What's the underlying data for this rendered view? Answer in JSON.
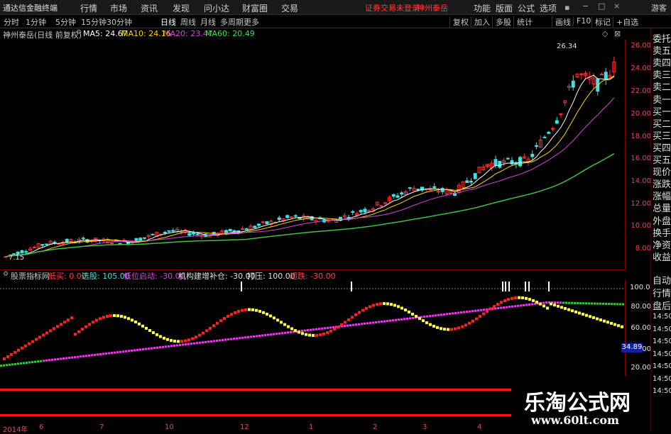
{
  "topbar": {
    "app_title": "通达信金融终端",
    "menu": [
      "行情",
      "市场",
      "资讯",
      "发现",
      "问小达",
      "财富圈",
      "交易"
    ],
    "warning": "证券交易未登录",
    "stock_name": "神州泰岳",
    "right_menu": [
      "功能",
      "版面",
      "公式",
      "选项"
    ],
    "guest": "游客"
  },
  "periods": [
    "分时",
    "1分钟",
    "5分钟",
    "15分钟",
    "30分钟",
    "日线",
    "周线",
    "月线",
    "多周期",
    "更多"
  ],
  "active_period": "日线",
  "right_buttons": [
    "复权",
    "加入",
    "多股",
    "统计",
    "画线",
    "F10",
    "标记",
    "+自选"
  ],
  "ma_line": {
    "title": "神州泰岳(日线 前复权)",
    "items": [
      {
        "label": "MA5: 24.67",
        "color": "#ffffff"
      },
      {
        "label": "MA10: 24.16",
        "color": "#ffd700"
      },
      {
        "label": "MA20: 23.47",
        "color": "#e040e0"
      },
      {
        "label": "MA60: 20.49",
        "color": "#40e040"
      }
    ]
  },
  "price_axis": [
    "26.00",
    "24.00",
    "22.00",
    "20.00",
    "18.00",
    "16.00",
    "14.00",
    "12.00",
    "10.00",
    "8.00"
  ],
  "high_label": "26.34",
  "low_label": "7.15",
  "right_panel": [
    "委托",
    "卖五",
    "卖四",
    "卖三",
    "卖二",
    "卖一",
    "买一",
    "买二",
    "买三",
    "买四",
    "买五",
    "现价",
    "涨跌",
    "涨幅",
    "总量",
    "外盘",
    "换手",
    "净资",
    "收益",
    "自动",
    "行情",
    "盘后",
    "14:50",
    "14:50",
    "14:50",
    "14:50",
    "14:50",
    "14:50",
    "14:50"
  ],
  "indicator": {
    "name": "股票指标网",
    "items": [
      {
        "label": "低买: 0.00",
        "color": "#ff4040"
      },
      {
        "label": "选股: 105.00",
        "color": "#40e0e0"
      },
      {
        "label": "低位启动: -30.00",
        "color": "#e040e0"
      },
      {
        "label": "机构建增补仓: -30.00",
        "color": "#e0e0e0"
      },
      {
        "label": "打压: 100.00",
        "color": "#e0e0e0"
      },
      {
        "label": "超跌: -30.00",
        "color": "#ff4040"
      }
    ],
    "axis": [
      "100.00",
      "80.00",
      "60.00",
      "40.00",
      "20.00"
    ],
    "value_box": "34.89"
  },
  "date_axis": [
    "2014年",
    "6",
    "7",
    "10",
    "12",
    "1",
    "2",
    "3",
    "4"
  ],
  "watermark": {
    "title": "乐淘公式网",
    "url": "www.60lt.com"
  },
  "colors": {
    "candle_up": "#ff3030",
    "candle_down": "#40e0e0",
    "ma5": "#ffffff",
    "ma10": "#ffd700",
    "ma20": "#e040e0",
    "ma60": "#40c040",
    "osc_red": "#ff2020",
    "osc_yellow": "#ffff40",
    "osc_magenta": "#e040e0",
    "osc_green": "#40c040"
  }
}
